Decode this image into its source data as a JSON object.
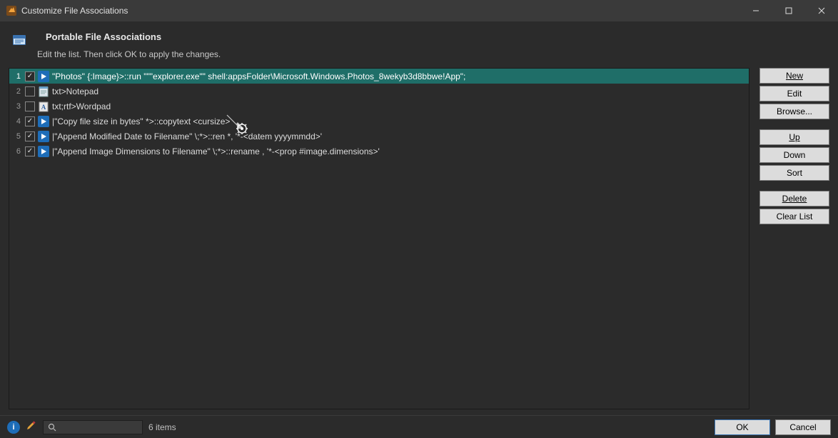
{
  "window": {
    "title": "Customize File Associations"
  },
  "header": {
    "title": "Portable File Associations",
    "subtitle": "Edit the list. Then click OK to apply the changes."
  },
  "rows": [
    {
      "n": "1",
      "checked": true,
      "icon": "play",
      "selected": true,
      "text": "\"Photos\" {:Image}>::run \"\"\"explorer.exe\"\" shell:appsFolder\\Microsoft.Windows.Photos_8wekyb3d8bbwe!App\";"
    },
    {
      "n": "2",
      "checked": false,
      "icon": "notepad",
      "selected": false,
      "text": "txt>Notepad"
    },
    {
      "n": "3",
      "checked": false,
      "icon": "wordpad",
      "selected": false,
      "text": "txt;rtf>Wordpad"
    },
    {
      "n": "4",
      "checked": true,
      "icon": "play",
      "selected": false,
      "text": "|\"Copy file size in bytes\" *>::copytext <cursize>"
    },
    {
      "n": "5",
      "checked": true,
      "icon": "play",
      "selected": false,
      "text": "|\"Append Modified Date to Filename\" \\;*>::ren *, '*-<datem yyyymmdd>'"
    },
    {
      "n": "6",
      "checked": true,
      "icon": "play",
      "selected": false,
      "text": "|\"Append Image Dimensions to Filename\" \\;*>::rename , '*-<prop #image.dimensions>'"
    }
  ],
  "side": {
    "new": "New",
    "edit": "Edit",
    "browse": "Browse...",
    "up": "Up",
    "down": "Down",
    "sort": "Sort",
    "delete": "Delete",
    "clear": "Clear List"
  },
  "status": {
    "count": "6 items"
  },
  "footer": {
    "ok": "OK",
    "cancel": "Cancel"
  }
}
